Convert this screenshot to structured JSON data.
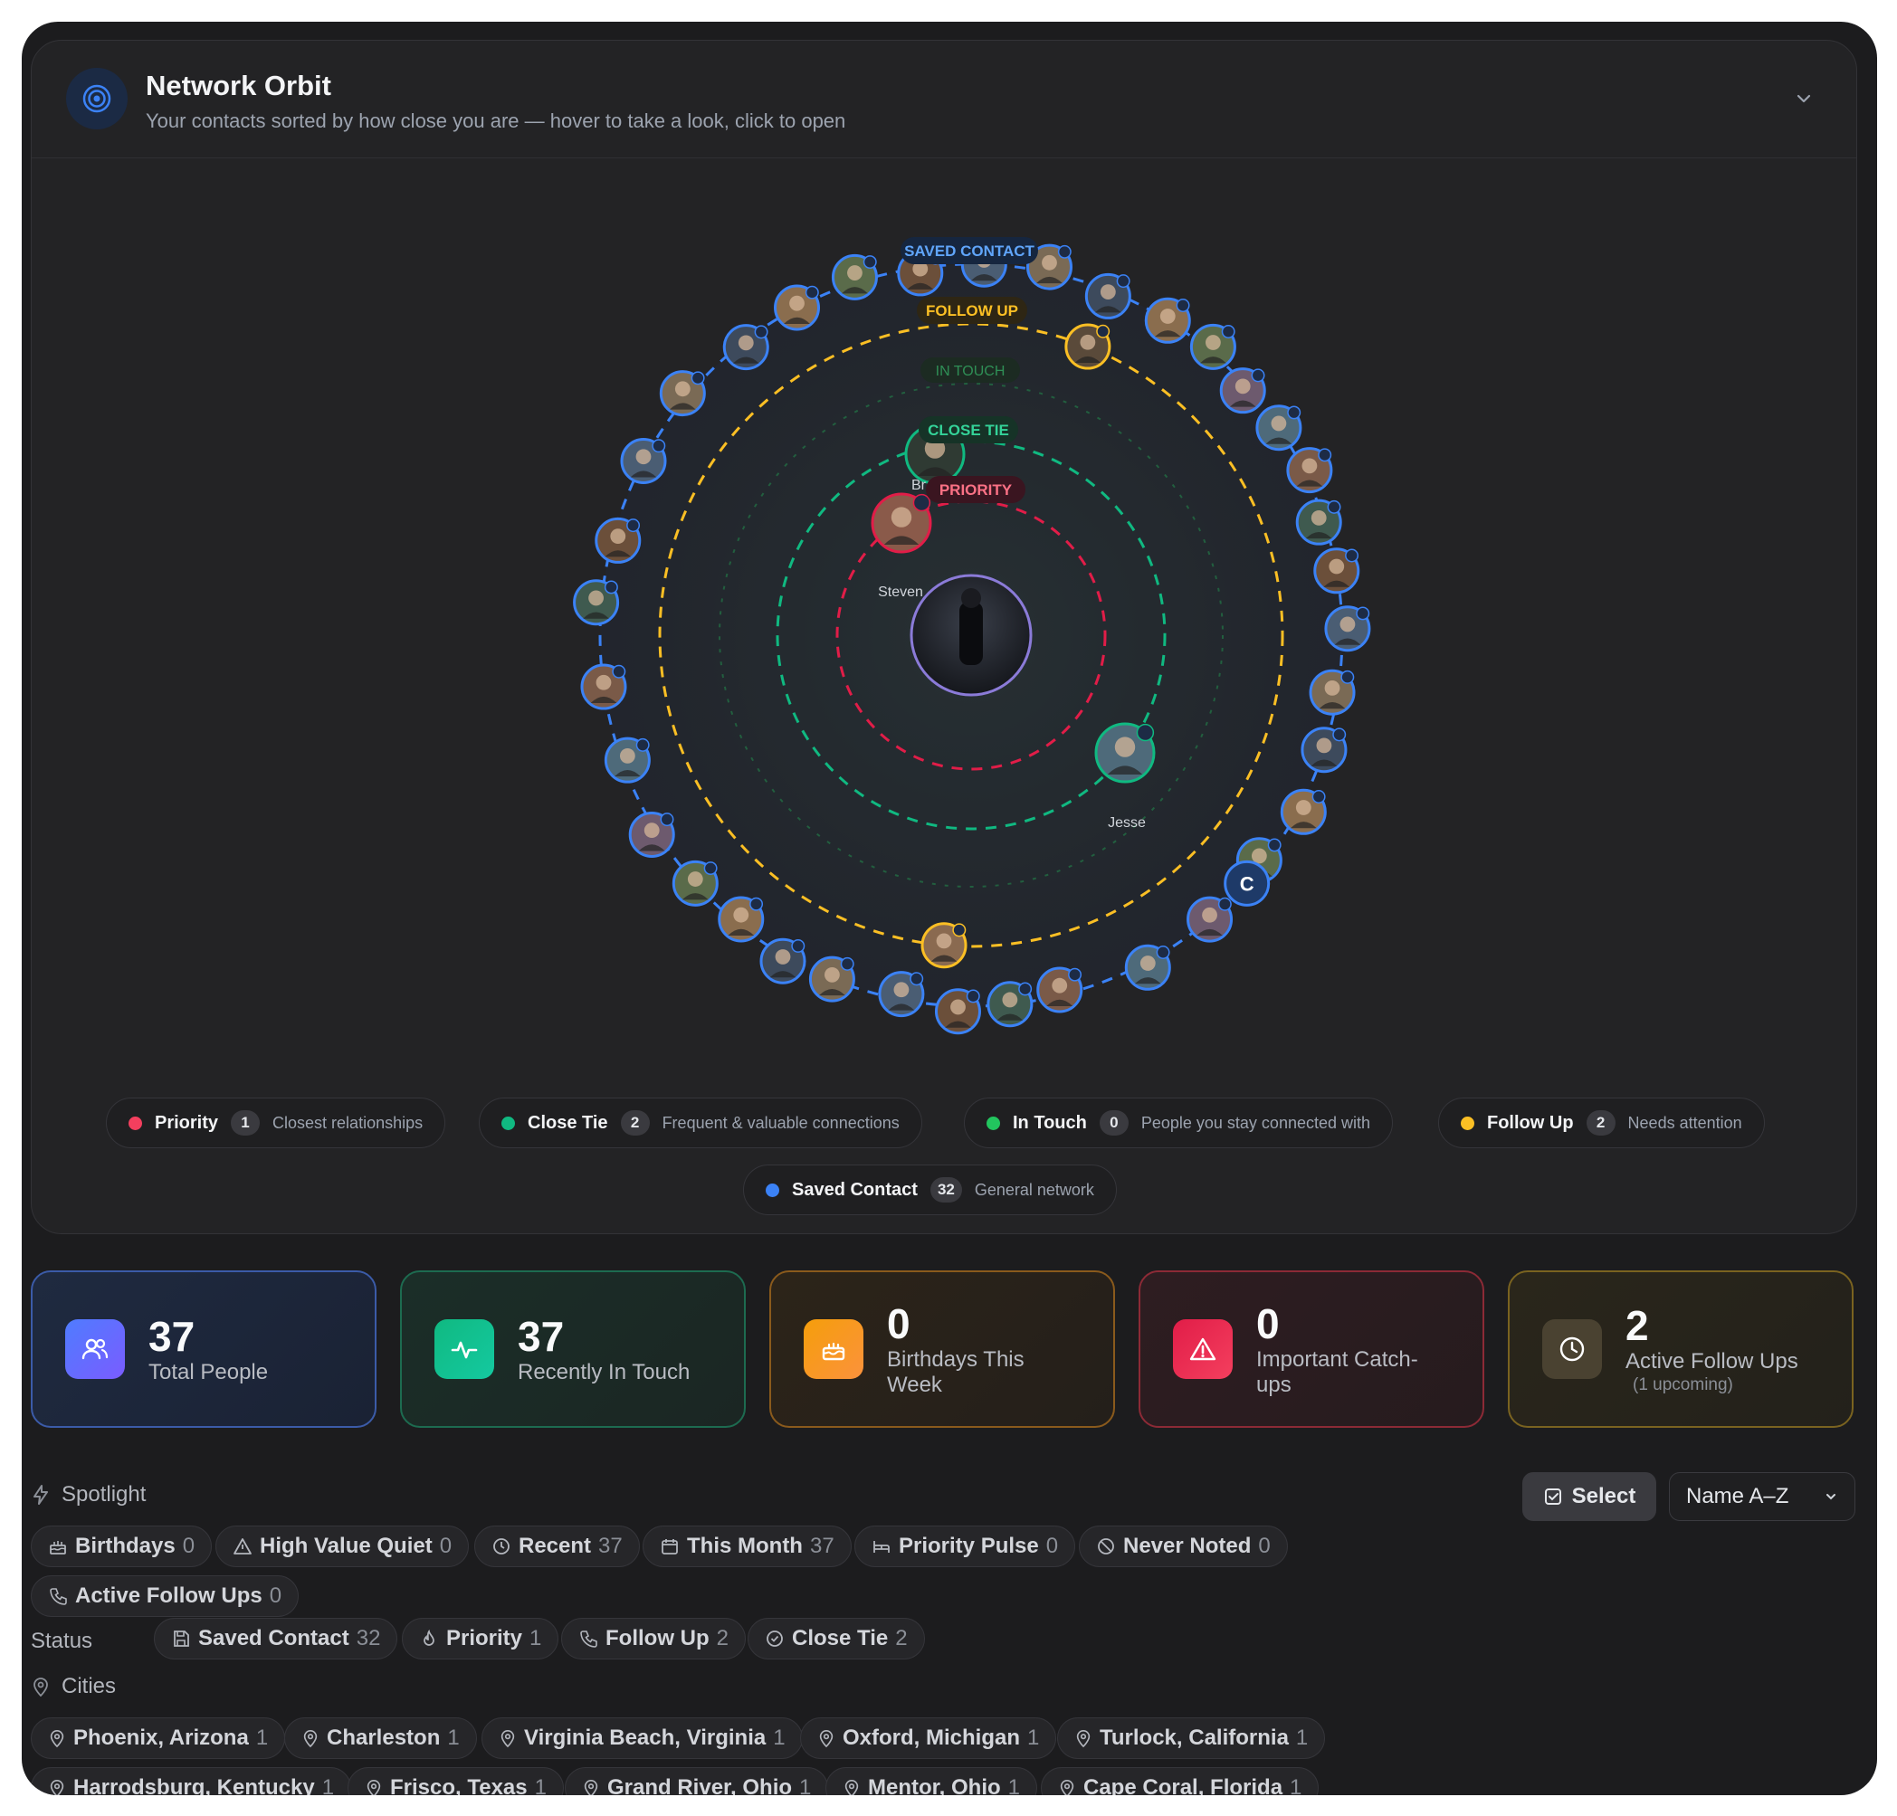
{
  "header": {
    "title": "Network Orbit",
    "subtitle": "Your contacts sorted by how close you are — hover to take a look, click to open"
  },
  "orbit": {
    "ring_labels": {
      "saved": "SAVED CONTACT",
      "follow": "FOLLOW UP",
      "intouch": "IN TOUCH",
      "close": "CLOSE TIE",
      "priority": "PRIORITY"
    },
    "named_contacts": {
      "steven": "Steven",
      "jesse": "Jesse",
      "initial": "C",
      "partial": "Br"
    },
    "colors": {
      "priority": "#e11d48",
      "close_tie": "#10b981",
      "in_touch": "#22c55e",
      "follow_up": "#fbbf24",
      "saved_contact": "#3b82f6"
    }
  },
  "legend": [
    {
      "name": "Priority",
      "count": "1",
      "desc": "Closest relationships",
      "color": "#f43f5e"
    },
    {
      "name": "Close Tie",
      "count": "2",
      "desc": "Frequent & valuable connections",
      "color": "#10b981"
    },
    {
      "name": "In Touch",
      "count": "0",
      "desc": "People you stay connected with",
      "color": "#22c55e"
    },
    {
      "name": "Follow Up",
      "count": "2",
      "desc": "Needs attention",
      "color": "#fbbf24"
    },
    {
      "name": "Saved Contact",
      "count": "32",
      "desc": "General network",
      "color": "#3b82f6"
    }
  ],
  "stats": [
    {
      "value": "37",
      "label": "Total People",
      "icon": "people-icon"
    },
    {
      "value": "37",
      "label": "Recently In Touch",
      "icon": "activity-icon"
    },
    {
      "value": "0",
      "label": "Birthdays This Week",
      "icon": "cake-icon"
    },
    {
      "value": "0",
      "label": "Important Catch-ups",
      "icon": "alert-icon"
    },
    {
      "value": "2",
      "label": "Active Follow Ups",
      "sub": "(1 upcoming)",
      "icon": "clock-icon"
    }
  ],
  "spotlight": {
    "label": "Spotlight",
    "chips": [
      {
        "label": "Birthdays",
        "count": "0"
      },
      {
        "label": "High Value Quiet",
        "count": "0"
      },
      {
        "label": "Recent",
        "count": "37"
      },
      {
        "label": "This Month",
        "count": "37"
      },
      {
        "label": "Priority Pulse",
        "count": "0"
      },
      {
        "label": "Never Noted",
        "count": "0"
      },
      {
        "label": "Active Follow Ups",
        "count": "0"
      }
    ]
  },
  "status": {
    "label": "Status",
    "chips": [
      {
        "label": "Saved Contact",
        "count": "32"
      },
      {
        "label": "Priority",
        "count": "1"
      },
      {
        "label": "Follow Up",
        "count": "2"
      },
      {
        "label": "Close Tie",
        "count": "2"
      }
    ]
  },
  "cities": {
    "label": "Cities",
    "chips": [
      {
        "label": "Phoenix, Arizona",
        "count": "1"
      },
      {
        "label": "Charleston",
        "count": "1"
      },
      {
        "label": "Virginia Beach, Virginia",
        "count": "1"
      },
      {
        "label": "Oxford, Michigan",
        "count": "1"
      },
      {
        "label": "Turlock, California",
        "count": "1"
      },
      {
        "label": "Harrodsburg, Kentucky",
        "count": "1"
      },
      {
        "label": "Frisco, Texas",
        "count": "1"
      },
      {
        "label": "Grand River, Ohio",
        "count": "1"
      },
      {
        "label": "Mentor, Ohio",
        "count": "1"
      },
      {
        "label": "Cape Coral, Florida",
        "count": "1"
      }
    ]
  },
  "toolbar": {
    "select_label": "Select",
    "sort_value": "Name A–Z"
  }
}
